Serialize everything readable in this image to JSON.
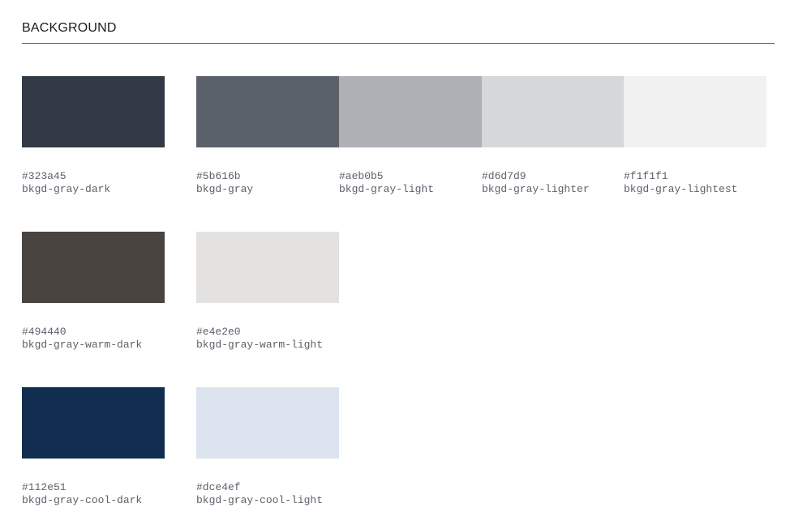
{
  "section": {
    "title": "BACKGROUND"
  },
  "rows": [
    {
      "swatches": [
        {
          "hex": "#323a45",
          "name": "bkgd-gray-dark",
          "color": "#323a45"
        },
        {
          "hex": "#5b616b",
          "name": "bkgd-gray",
          "color": "#5b616b"
        },
        {
          "hex": "#aeb0b5",
          "name": "bkgd-gray-light",
          "color": "#aeb0b5"
        },
        {
          "hex": "#d6d7d9",
          "name": "bkgd-gray-lighter",
          "color": "#d6d7d9"
        },
        {
          "hex": "#f1f1f1",
          "name": "bkgd-gray-lightest",
          "color": "#f1f1f1"
        }
      ]
    },
    {
      "swatches": [
        {
          "hex": "#494440",
          "name": "bkgd-gray-warm-dark",
          "color": "#494440"
        },
        {
          "hex": "#e4e2e0",
          "name": "bkgd-gray-warm-light",
          "color": "#e4e2e0"
        }
      ]
    },
    {
      "swatches": [
        {
          "hex": "#112e51",
          "name": "bkgd-gray-cool-dark",
          "color": "#112e51"
        },
        {
          "hex": "#dce4ef",
          "name": "bkgd-gray-cool-light",
          "color": "#dce4ef"
        }
      ]
    }
  ]
}
